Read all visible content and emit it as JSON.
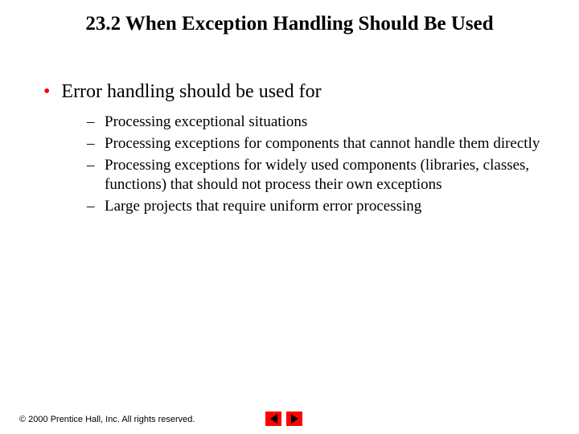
{
  "title": "23.2  When Exception Handling Should Be Used",
  "main_bullet": {
    "marker": "•",
    "text": "Error handling should be used for"
  },
  "sub_items": [
    "Processing exceptional situations",
    "Processing exceptions for components that cannot handle them directly",
    "Processing exceptions for widely used components (libraries, classes, functions) that should not process their own exceptions",
    "Large projects that require uniform error processing"
  ],
  "footer": "© 2000 Prentice Hall, Inc.  All rights reserved.",
  "colors": {
    "accent": "#ff0000"
  }
}
